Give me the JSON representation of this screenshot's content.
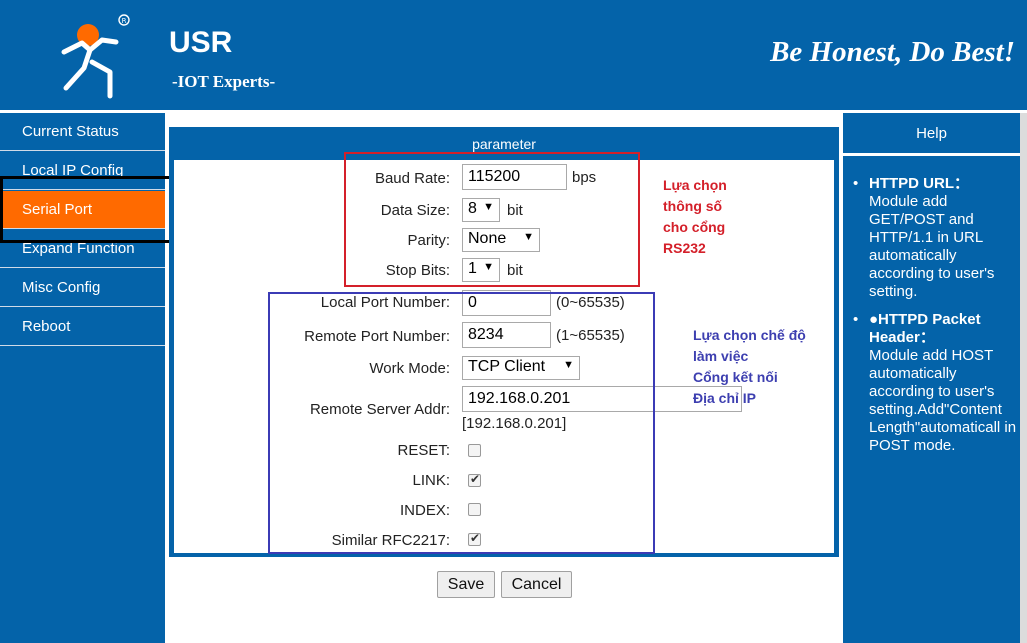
{
  "header": {
    "brand": "USR",
    "subtitle": "-IOT Experts-",
    "slogan": "Be Honest, Do Best!"
  },
  "sidebar": {
    "items": [
      {
        "label": "Current Status"
      },
      {
        "label": "Local IP Config"
      },
      {
        "label": "Serial Port"
      },
      {
        "label": "Expand Function"
      },
      {
        "label": "Misc Config"
      },
      {
        "label": "Reboot"
      }
    ],
    "active_index": 2
  },
  "panel": {
    "title": "parameter",
    "baud_rate": {
      "label": "Baud Rate:",
      "value": "115200",
      "unit": "bps"
    },
    "data_size": {
      "label": "Data Size:",
      "value": "8",
      "unit": "bit"
    },
    "parity": {
      "label": "Parity:",
      "value": "None"
    },
    "stop_bits": {
      "label": "Stop Bits:",
      "value": "1",
      "unit": "bit"
    },
    "local_port": {
      "label": "Local Port Number:",
      "value": "0",
      "range": "(0~65535)"
    },
    "remote_port": {
      "label": "Remote Port Number:",
      "value": "8234",
      "range": "(1~65535)"
    },
    "work_mode": {
      "label": "Work Mode:",
      "value": "TCP Client"
    },
    "remote_addr": {
      "label": "Remote Server Addr:",
      "value": "192.168.0.201",
      "resolved": "[192.168.0.201]"
    },
    "reset": {
      "label": "RESET:",
      "checked": false
    },
    "link": {
      "label": "LINK:",
      "checked": true
    },
    "index": {
      "label": "INDEX:",
      "checked": false
    },
    "rfc2217": {
      "label": "Similar RFC2217:",
      "checked": true
    }
  },
  "annotations": {
    "red": [
      "Lựa chọn",
      "thông số",
      "cho cổng",
      "RS232"
    ],
    "blue": [
      "Lựa chọn chế độ",
      "làm việc",
      "Cổng kết nối",
      "Địa chỉ IP"
    ]
  },
  "buttons": {
    "save": "Save",
    "cancel": "Cancel"
  },
  "help": {
    "title": "Help",
    "items": [
      {
        "bullet": "•",
        "head": "HTTPD URL：",
        "body": "Module add GET/POST and HTTP/1.1 in URL automatically according to user's setting."
      },
      {
        "bullet": "•",
        "head": "●HTTPD Packet Header：",
        "body": "Module add HOST automatically according to user's setting.Add\"Content Length\"automaticall in POST mode."
      }
    ]
  },
  "colors": {
    "primary_blue": "#0463a9",
    "active_orange": "#ff6a00",
    "red_annotation": "#d4202a",
    "blue_annotation": "#3d3fb0"
  }
}
